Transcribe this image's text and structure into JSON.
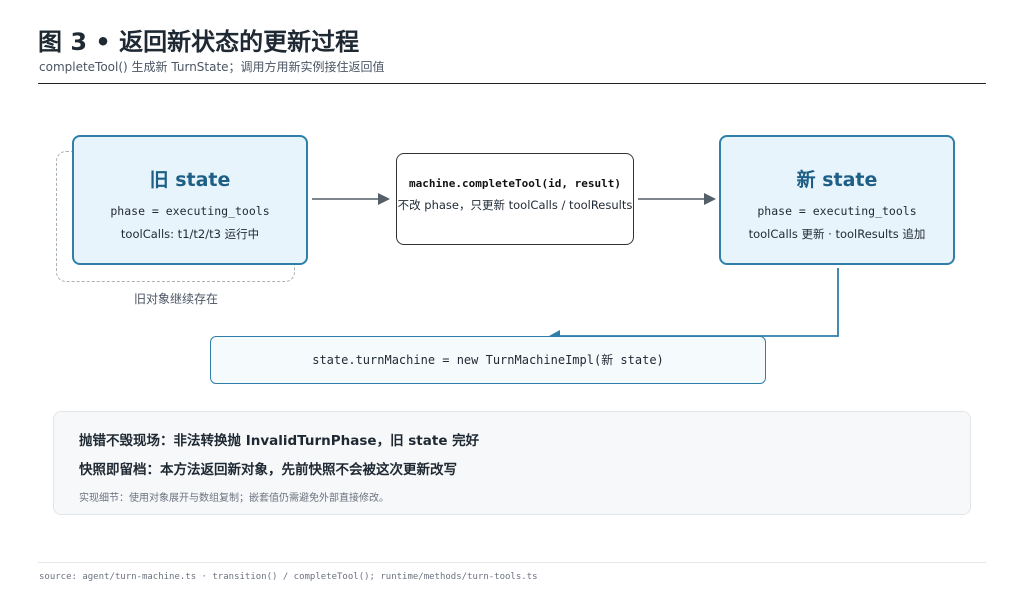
{
  "header": {
    "title": "图 3 • 返回新状态的更新过程",
    "subtitle": "completeTool() 生成新 TurnState；调用方用新实例接住返回值"
  },
  "diagram": {
    "old_state": {
      "title": "旧 state",
      "phase": "phase = executing_tools",
      "tool_calls": "toolCalls: t1/t2/t3 运行中",
      "ghost_label": "旧对象继续存在"
    },
    "call": {
      "code": "machine.completeTool(id, result)",
      "note": "不改 phase，只更新 toolCalls / toolResults"
    },
    "new_state": {
      "title": "新 state",
      "phase": "phase = executing_tools",
      "tool_calls": "toolCalls 更新 · toolResults 追加"
    },
    "assignment": "state.turnMachine = new TurnMachineImpl(新 state)"
  },
  "notes": {
    "line1": "抛错不毁现场：非法转换抛 InvalidTurnPhase，旧 state 完好",
    "line2": "快照即留档：本方法返回新对象，先前快照不会被这次更新改写",
    "detail": "实现细节：使用对象展开与数组复制；嵌套值仍需避免外部直接修改。"
  },
  "footer": {
    "source": "source: agent/turn-machine.ts · transition() / completeTool(); runtime/methods/turn-tools.ts"
  },
  "colors": {
    "accent": "#2f7fa8",
    "state_fill": "#e8f4fb",
    "arrow": "#555f69"
  }
}
